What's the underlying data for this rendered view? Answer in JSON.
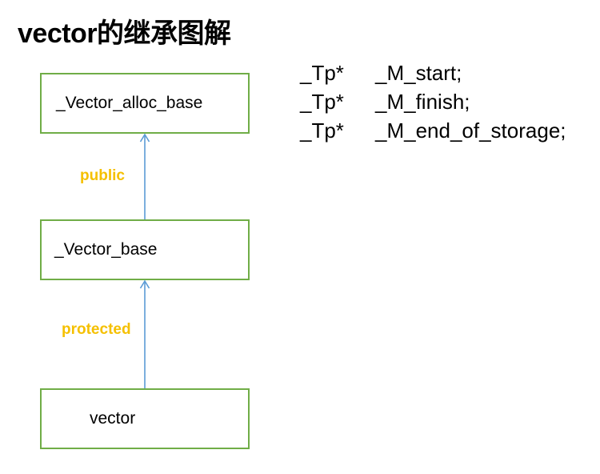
{
  "title": "vector的继承图解",
  "classes": {
    "alloc_base": "_Vector_alloc_base",
    "base": "_Vector_base",
    "vector": "vector"
  },
  "inheritance": {
    "public_label": "public",
    "protected_label": "protected"
  },
  "members": [
    {
      "type": "_Tp*",
      "name": "_M_start;"
    },
    {
      "type": "_Tp*",
      "name": "_M_finish;"
    },
    {
      "type": "_Tp*",
      "name": "_M_end_of_storage;"
    }
  ],
  "colors": {
    "box_border": "#70ad47",
    "arrow": "#5b9bd5",
    "inheritance_label": "#f5c000"
  }
}
